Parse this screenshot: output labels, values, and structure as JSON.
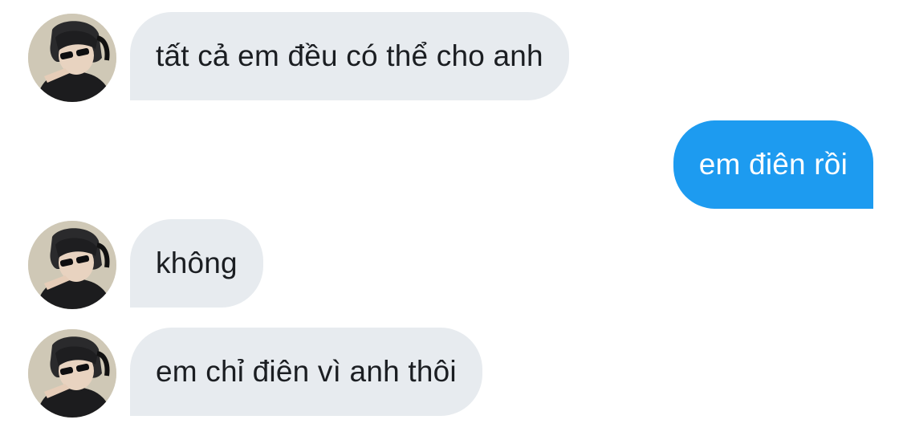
{
  "conversation": {
    "messages": [
      {
        "sender": "contact",
        "text": "tất cả em đều có thể cho anh"
      },
      {
        "sender": "me",
        "text": "em điên rồi"
      },
      {
        "sender": "contact",
        "text": "không"
      },
      {
        "sender": "contact",
        "text": "em chỉ điên vì anh thôi"
      }
    ],
    "contact_avatar_icon": "profile-photo-icon",
    "colors": {
      "incoming_bubble": "#e7ebef",
      "outgoing_bubble": "#1d9bf0",
      "incoming_text": "#1b1e22",
      "outgoing_text": "#ffffff"
    }
  }
}
